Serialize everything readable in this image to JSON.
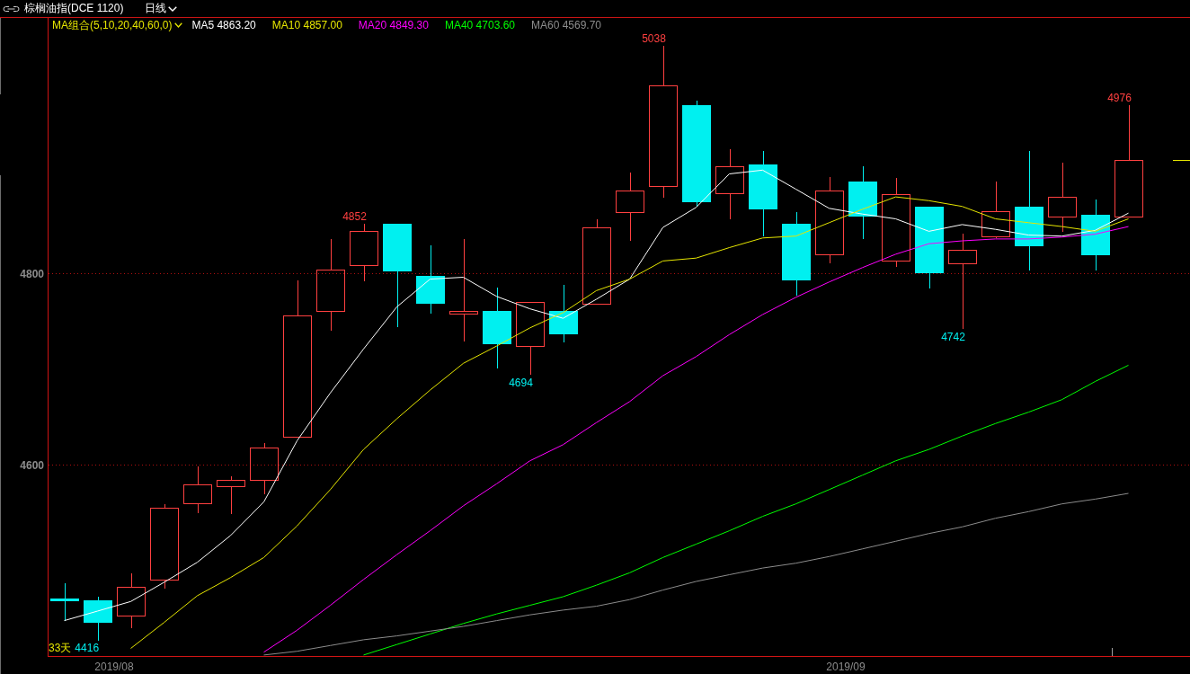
{
  "header": {
    "title": "棕榈油指(DCE 1120)",
    "period": "日线"
  },
  "chart": {
    "indicator": {
      "label": "MA组合(5,10,20,40,60,0)"
    },
    "ma_readings": [
      "4863.20",
      "4857.00",
      "4849.30",
      "4703.60",
      "4569.70"
    ],
    "price_marks": [
      {
        "text": "4852",
        "kind": "high"
      },
      {
        "text": "4694",
        "kind": "low"
      },
      {
        "text": "5038",
        "kind": "high"
      },
      {
        "text": "4742",
        "kind": "low"
      },
      {
        "text": "4976",
        "kind": "high"
      }
    ],
    "date_labels": [
      "2019/08",
      "2019/09"
    ],
    "range_info": {
      "days": "33天",
      "low": "4416"
    },
    "chart_data": {
      "type": "line",
      "ylim": [
        4400,
        5067
      ],
      "yticks": [
        4600,
        4800
      ],
      "series": [
        {
          "name": "MA5",
          "color": "#ffffff",
          "values": [
            4437,
            4447,
            4457,
            4477,
            4498,
            4526,
            4561,
            4625,
            4675,
            4721,
            4765,
            4794,
            4796,
            4776,
            4763,
            4753,
            4773,
            4794,
            4848,
            4869,
            4904,
            4908,
            4888,
            4868,
            4862,
            4857,
            4844,
            4851,
            4846,
            4840,
            4839,
            4845,
            4863
          ]
        },
        {
          "name": "MA10",
          "color": "#e6e600",
          "values": [
            null,
            null,
            4408,
            4435,
            4463,
            4482,
            4503,
            4536,
            4574,
            4616,
            4648,
            4678,
            4706,
            4724,
            4743,
            4759,
            4782,
            4794,
            4813,
            4816,
            4827,
            4837,
            4839,
            4853,
            4867,
            4880,
            4876,
            4870,
            4857,
            4853,
            4849,
            4844,
            4857
          ]
        },
        {
          "name": "MA20",
          "color": "#ff00ff",
          "values": [
            null,
            null,
            null,
            null,
            null,
            null,
            4404,
            4427,
            4453,
            4480,
            4506,
            4531,
            4557,
            4580,
            4604,
            4621,
            4644,
            4666,
            4693,
            4713,
            4736,
            4757,
            4775,
            4791,
            4806,
            4820,
            4831,
            4834,
            4836,
            4836,
            4838,
            4841,
            4849
          ]
        },
        {
          "name": "MA40",
          "color": "#00ff00",
          "values": [
            null,
            null,
            null,
            null,
            null,
            null,
            null,
            null,
            null,
            4401,
            4412,
            4423,
            4434,
            4444,
            4453,
            4462,
            4474,
            4487,
            4503,
            4517,
            4531,
            4546,
            4559,
            4574,
            4589,
            4604,
            4616,
            4630,
            4643,
            4655,
            4668,
            4687,
            4704
          ]
        },
        {
          "name": "MA60",
          "color": "#8c8c8c",
          "values": [
            null,
            null,
            null,
            null,
            null,
            null,
            4401,
            4405,
            4411,
            4417,
            4421,
            4426,
            4431,
            4437,
            4443,
            4448,
            4452,
            4459,
            4469,
            4478,
            4485,
            4492,
            4497,
            4504,
            4512,
            4520,
            4528,
            4535,
            4544,
            4551,
            4559,
            4564,
            4570
          ]
        }
      ]
    }
  }
}
